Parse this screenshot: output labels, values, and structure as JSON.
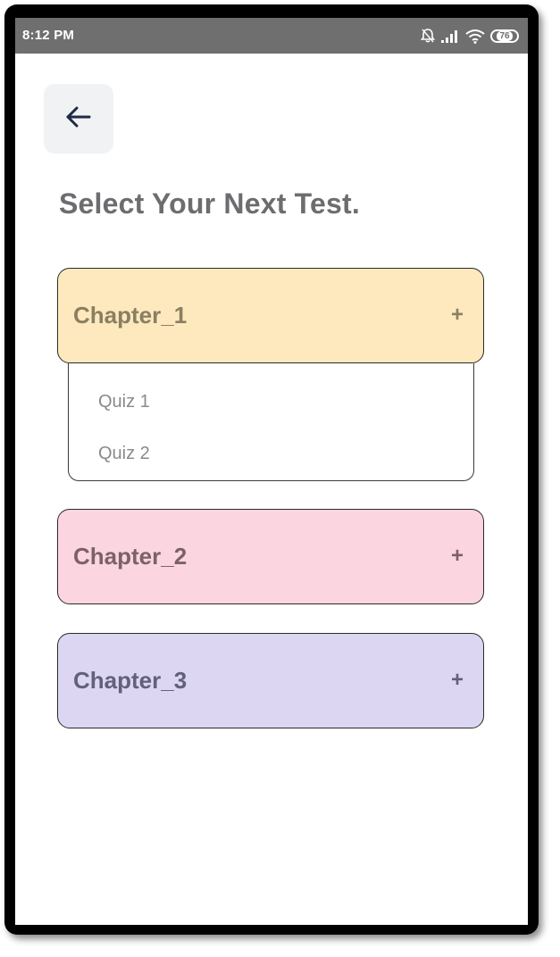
{
  "status_bar": {
    "time": "8:12 PM",
    "battery_level": "76",
    "icons": [
      "alarm-icon",
      "signal-icon",
      "wifi-icon",
      "battery-icon"
    ]
  },
  "header": {
    "back_icon": "arrow-left-icon",
    "title": "Select Your Next Test."
  },
  "chapters": [
    {
      "label": "Chapter_1",
      "toggle": "+",
      "color": "#fde9bd",
      "expanded": true,
      "quizzes": [
        "Quiz 1",
        "Quiz 2"
      ]
    },
    {
      "label": "Chapter_2",
      "toggle": "+",
      "color": "#fbd5df",
      "expanded": false
    },
    {
      "label": "Chapter_3",
      "toggle": "+",
      "color": "#dcd6f2",
      "expanded": false
    }
  ]
}
